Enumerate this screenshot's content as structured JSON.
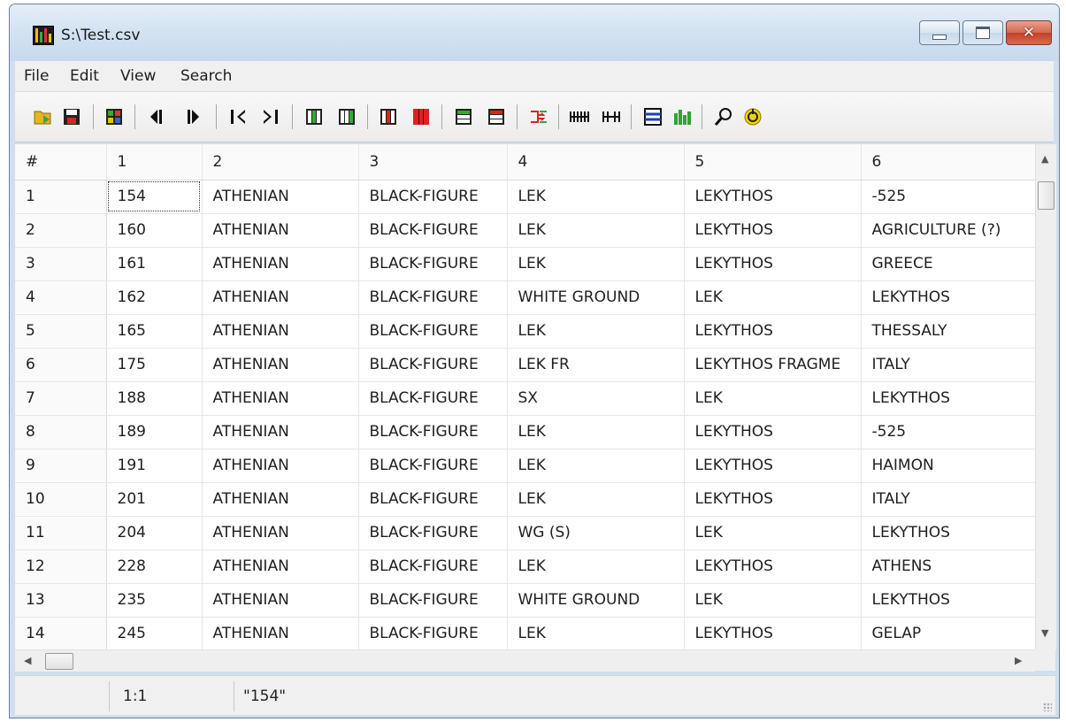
{
  "window": {
    "title": "S:\\Test.csv",
    "buttons": {
      "minimize": "minimize",
      "maximize": "maximize",
      "close": "✕"
    }
  },
  "menu": [
    "File",
    "Edit",
    "View",
    "Search"
  ],
  "toolbar": {
    "icons": [
      "open-file-icon",
      "save-icon",
      "grid-icon",
      "previous-column-icon",
      "next-column-icon",
      "first-column-icon",
      "last-column-icon",
      "insert-column-icon",
      "insert-column-after-icon",
      "delete-column-icon",
      "delete-columns-icon",
      "insert-row-icon",
      "delete-row-icon",
      "merge-icon",
      "collapse-columns-icon",
      "expand-columns-icon",
      "list-view-icon",
      "chart-icon",
      "find-icon",
      "refresh-icon"
    ]
  },
  "grid": {
    "headers": [
      "#",
      "1",
      "2",
      "3",
      "4",
      "5",
      "6"
    ],
    "rows": [
      [
        "1",
        "154",
        "ATHENIAN",
        "BLACK-FIGURE",
        "LEK",
        "LEKYTHOS",
        "-525"
      ],
      [
        "2",
        "160",
        "ATHENIAN",
        "BLACK-FIGURE",
        "LEK",
        "LEKYTHOS",
        "AGRICULTURE (?)"
      ],
      [
        "3",
        "161",
        "ATHENIAN",
        "BLACK-FIGURE",
        "LEK",
        "LEKYTHOS",
        "GREECE"
      ],
      [
        "4",
        "162",
        "ATHENIAN",
        "BLACK-FIGURE",
        "WHITE GROUND",
        "LEK",
        "LEKYTHOS"
      ],
      [
        "5",
        "165",
        "ATHENIAN",
        "BLACK-FIGURE",
        "LEK",
        "LEKYTHOS",
        "THESSALY"
      ],
      [
        "6",
        "175",
        "ATHENIAN",
        "BLACK-FIGURE",
        "LEK FR",
        "LEKYTHOS FRAGME",
        "ITALY"
      ],
      [
        "7",
        "188",
        "ATHENIAN",
        "BLACK-FIGURE",
        "SX",
        "LEK",
        "LEKYTHOS"
      ],
      [
        "8",
        "189",
        "ATHENIAN",
        "BLACK-FIGURE",
        "LEK",
        "LEKYTHOS",
        "-525"
      ],
      [
        "9",
        "191",
        "ATHENIAN",
        "BLACK-FIGURE",
        "LEK",
        "LEKYTHOS",
        "HAIMON"
      ],
      [
        "10",
        "201",
        "ATHENIAN",
        "BLACK-FIGURE",
        "LEK",
        "LEKYTHOS",
        "ITALY"
      ],
      [
        "11",
        "204",
        "ATHENIAN",
        "BLACK-FIGURE",
        "WG (S)",
        "LEK",
        "LEKYTHOS"
      ],
      [
        "12",
        "228",
        "ATHENIAN",
        "BLACK-FIGURE",
        "LEK",
        "LEKYTHOS",
        "ATHENS"
      ],
      [
        "13",
        "235",
        "ATHENIAN",
        "BLACK-FIGURE",
        "WHITE GROUND",
        "LEK",
        "LEKYTHOS"
      ],
      [
        "14",
        "245",
        "ATHENIAN",
        "BLACK-FIGURE",
        "LEK",
        "LEKYTHOS",
        "GELAP"
      ]
    ]
  },
  "status": {
    "position": "1:1",
    "value": "\"154\""
  }
}
